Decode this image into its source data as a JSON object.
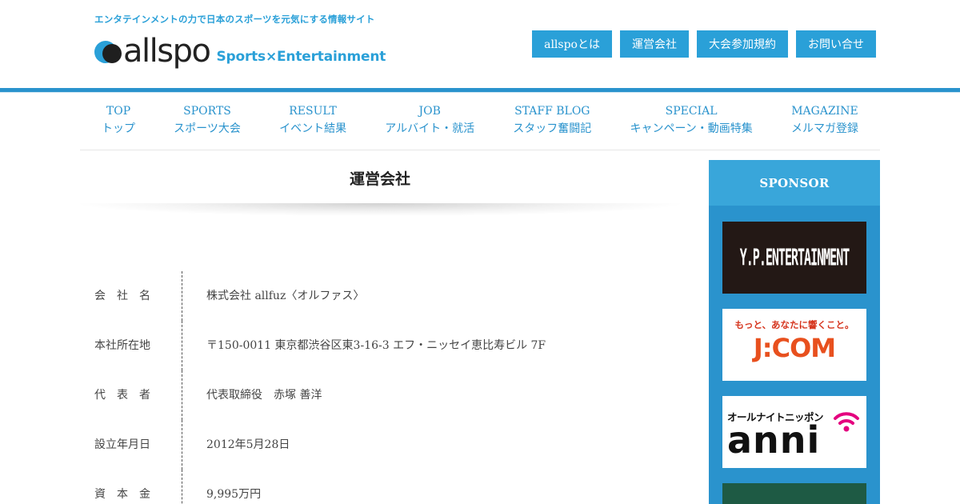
{
  "header": {
    "tagline": "エンタテインメントの力で日本のスポーツを元気にする情報サイト",
    "logo_text": "allspo",
    "logo_sub": "Sports×Entertainment",
    "brand_color": "#2aa0d8"
  },
  "top_nav": [
    {
      "label": "allspoとは"
    },
    {
      "label": "運営会社"
    },
    {
      "label": "大会参加規約"
    },
    {
      "label": "お問い合せ"
    }
  ],
  "main_nav": [
    {
      "en": "TOP",
      "ja": "トップ"
    },
    {
      "en": "SPORTS",
      "ja": "スポーツ大会"
    },
    {
      "en": "RESULT",
      "ja": "イベント結果"
    },
    {
      "en": "JOB",
      "ja": "アルバイト・就活"
    },
    {
      "en": "STAFF BLOG",
      "ja": "スタッフ奮闘記"
    },
    {
      "en": "SPECIAL",
      "ja": "キャンペーン・動画特集"
    },
    {
      "en": "MAGAZINE",
      "ja": "メルマガ登録"
    }
  ],
  "page": {
    "title": "運営会社"
  },
  "company_info": [
    {
      "label": "会　社　名",
      "value": "株式会社 allfuz〈オルファス〉"
    },
    {
      "label": "本社所在地",
      "value": "〒150-0011 東京都渋谷区東3-16-3 エフ・ニッセイ恵比寿ビル 7F"
    },
    {
      "label": "代　表　者",
      "value": "代表取締役　赤塚 善洋"
    },
    {
      "label": "設立年月日",
      "value": "2012年5月28日"
    },
    {
      "label": "資　本　金",
      "value": "9,995万円"
    }
  ],
  "sidebar": {
    "heading": "SPONSOR",
    "banners": {
      "yp": "Y.P.ENTERTAINMENT",
      "jcom_tag": "もっと、あなたに響くこと。",
      "jcom_brand": "J:COM",
      "anni_tag": "オールナイトニッポン",
      "anni_brand": "anni"
    }
  }
}
